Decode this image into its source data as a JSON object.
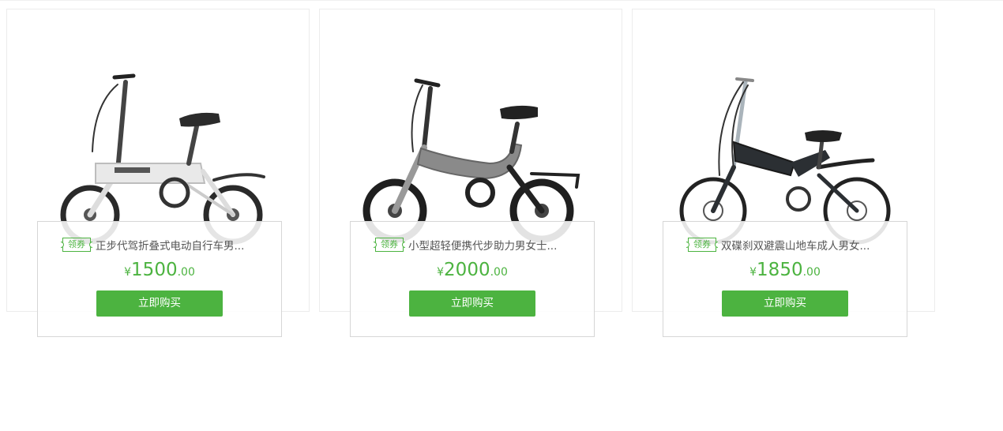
{
  "products": [
    {
      "coupon_label": "领券",
      "title": "正步代驾折叠式电动自行车男...",
      "currency": "¥",
      "price_int": "1500",
      "price_dec": ".00",
      "buy_label": "立即购买",
      "image": "white-folding-e-bike",
      "frame_color": "#e9e9e9"
    },
    {
      "coupon_label": "领券",
      "title": "小型超轻便携代步助力男女士...",
      "currency": "¥",
      "price_int": "2000",
      "price_dec": ".00",
      "buy_label": "立即购买",
      "image": "gray-folding-e-bike",
      "frame_color": "#8a8a8a"
    },
    {
      "coupon_label": "领券",
      "title": "双碟刹双避震山地车成人男女...",
      "currency": "¥",
      "price_int": "1850",
      "price_dec": ".00",
      "buy_label": "立即购买",
      "image": "black-folding-mountain-bike",
      "frame_color": "#2b2f33"
    }
  ],
  "accent_color": "#4cb340"
}
